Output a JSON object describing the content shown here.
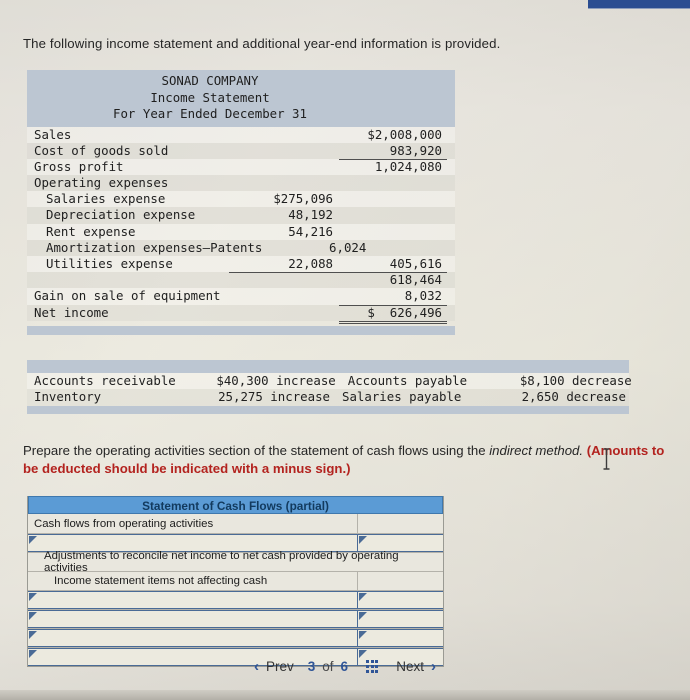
{
  "intro": "The following income statement and additional year-end information is provided.",
  "income_statement": {
    "title_lines": [
      "SONAD COMPANY",
      "Income Statement",
      "For Year Ended December 31"
    ],
    "rows": [
      {
        "label": "Sales",
        "c1": "",
        "c2": "$2,008,000",
        "c1_rule": "none",
        "c2_rule": "none"
      },
      {
        "label": "Cost of goods sold",
        "c1": "",
        "c2": "983,920",
        "c1_rule": "none",
        "c2_rule": "underline"
      },
      {
        "label": "Gross profit",
        "c1": "",
        "c2": "1,024,080",
        "c1_rule": "none",
        "c2_rule": "none"
      },
      {
        "label": "Operating expenses",
        "c1": "",
        "c2": "",
        "c1_rule": "none",
        "c2_rule": "none"
      },
      {
        "label": "Salaries expense",
        "c1": "$275,096",
        "c2": "",
        "indent": true,
        "c1_rule": "none",
        "c2_rule": "none"
      },
      {
        "label": "Depreciation expense",
        "c1": "48,192",
        "c2": "",
        "indent": true,
        "c1_rule": "none",
        "c2_rule": "none"
      },
      {
        "label": "Rent expense",
        "c1": "54,216",
        "c2": "",
        "indent": true,
        "c1_rule": "none",
        "c2_rule": "none"
      },
      {
        "label": "Amortization expenses–Patents",
        "c1": "6,024",
        "c2": "",
        "indent": true,
        "c1_rule": "none",
        "c2_rule": "none"
      },
      {
        "label": "Utilities expense",
        "c1": "22,088",
        "c2": "405,616",
        "indent": true,
        "c1_rule": "underline",
        "c2_rule": "underline"
      },
      {
        "label": "",
        "c1": "",
        "c2": "618,464",
        "c1_rule": "none",
        "c2_rule": "none"
      },
      {
        "label": "Gain on sale of equipment",
        "c1": "",
        "c2": "8,032",
        "c1_rule": "none",
        "c2_rule": "underline"
      },
      {
        "label": "Net income",
        "c1": "",
        "c2": "$  626,496",
        "c1_rule": "none",
        "c2_rule": "double"
      }
    ]
  },
  "year_end_changes": {
    "rows": [
      {
        "a": "Accounts receivable",
        "b": "$40,300 increase",
        "c": "Accounts payable",
        "d": "$8,100 decrease"
      },
      {
        "a": "Inventory",
        "b": "25,275 increase",
        "c": "Salaries payable",
        "d": "2,650 decrease"
      }
    ]
  },
  "prompt": {
    "part1": "Prepare the operating activities section of the statement of cash flows using the ",
    "italic": "indirect method.",
    "red": " (Amounts to be deducted should be indicated with a minus sign.)"
  },
  "cash_flow_table": {
    "title": "Statement of Cash Flows (partial)",
    "rows": [
      {
        "label": "Cash flows from operating activities",
        "indent": 0,
        "input": false,
        "full": false,
        "value": ""
      },
      {
        "label": "",
        "indent": 0,
        "input": true,
        "full": false,
        "value": ""
      },
      {
        "label": "Adjustments to reconcile net income to net cash provided by operating activities",
        "indent": 1,
        "input": false,
        "full": true,
        "value": ""
      },
      {
        "label": "Income statement items not affecting cash",
        "indent": 2,
        "input": false,
        "full": false,
        "value": ""
      },
      {
        "label": "",
        "indent": 0,
        "input": true,
        "full": false,
        "value": ""
      },
      {
        "label": "",
        "indent": 0,
        "input": true,
        "full": false,
        "value": ""
      },
      {
        "label": "",
        "indent": 0,
        "input": true,
        "full": false,
        "value": ""
      },
      {
        "label": "",
        "indent": 0,
        "input": true,
        "full": false,
        "value": ""
      }
    ]
  },
  "pager": {
    "prev_label": "Prev",
    "next_label": "Next",
    "current_page": "3",
    "of_label": "of",
    "total_pages": "6",
    "prev_chevron": "‹",
    "next_chevron": "›"
  },
  "colors": {
    "accent_blue": "#5b9bd5",
    "header_gray": "#bcc6d2",
    "link_blue": "#2f5597",
    "alert_red": "#b3231f",
    "topbar_blue": "#2b4d91"
  }
}
